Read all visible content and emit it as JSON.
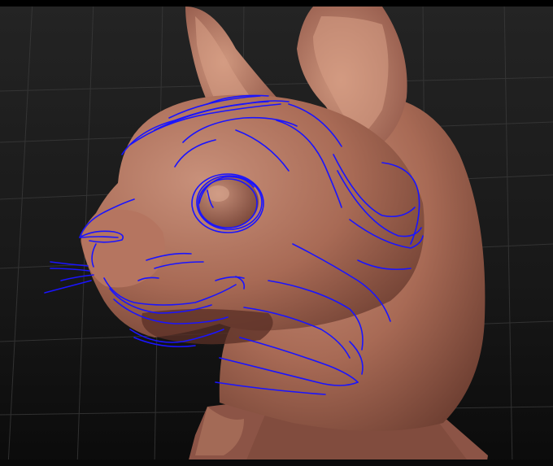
{
  "viewport": {
    "background_top": "#222222",
    "background_bottom": "#0d0d0d",
    "frame_color": "#000000",
    "grid_color": "#3c3c3c",
    "clay_color": "#a86a55",
    "clay_shadow": "#6e3f32",
    "clay_highlight": "#cf977e",
    "sketch_color": "#1a14ff"
  },
  "model": {
    "subject": "cat-head-sculpt-icon",
    "overlay": "blue-sketch-lines-icon"
  }
}
